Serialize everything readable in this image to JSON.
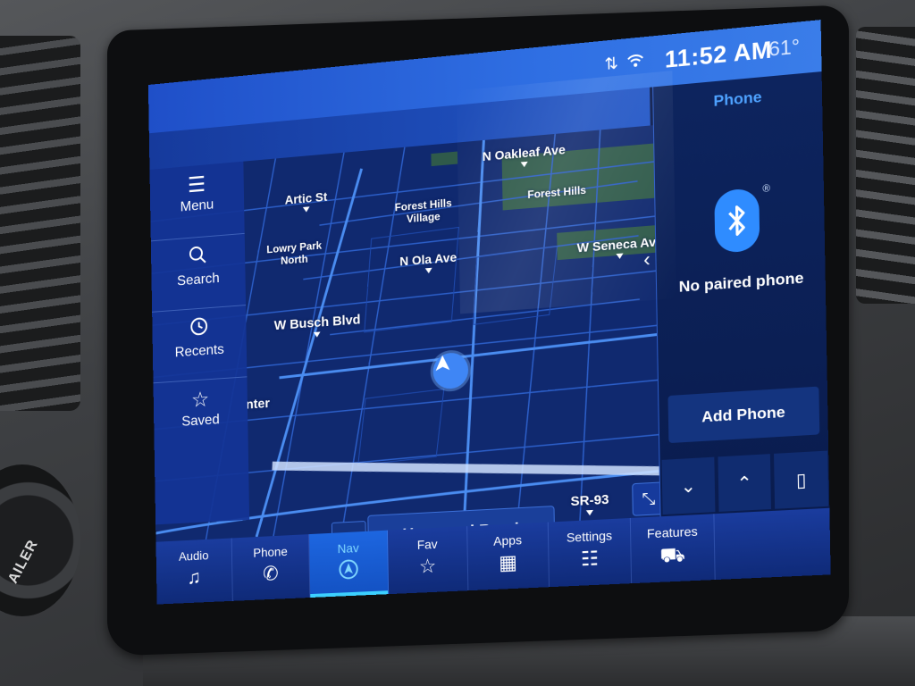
{
  "status": {
    "time": "11:52 AM",
    "temperature": "61°",
    "signal_icon": "signal-arrows-icon",
    "wifi_icon": "wifi-icon"
  },
  "side_menu": {
    "items": [
      {
        "label": "Menu",
        "icon": "hamburger-icon"
      },
      {
        "label": "Search",
        "icon": "search-icon"
      },
      {
        "label": "Recents",
        "icon": "clock-icon"
      },
      {
        "label": "Saved",
        "icon": "star-icon"
      }
    ]
  },
  "map": {
    "labels": {
      "oakleaf": "N Oakleaf Ave",
      "artic": "Artic St",
      "forest_hills_village": "Forest Hills Village",
      "forest_hills": "Forest Hills",
      "lowry_park": "Lowry Park North",
      "ola": "N Ola Ave",
      "seneca": "W Seneca Ave",
      "busch": "W Busch Blvd",
      "inter": "nter"
    },
    "current_road": "Unnamed Road",
    "heading": "W",
    "route": "SR-93"
  },
  "phone_panel": {
    "title": "Phone",
    "status": "No paired phone",
    "add_button": "Add Phone",
    "registered_mark": "®"
  },
  "bottom_nav": {
    "items": [
      {
        "label": "Audio",
        "icon": "music-note-icon"
      },
      {
        "label": "Phone",
        "icon": "phone-icon"
      },
      {
        "label": "Nav",
        "icon": "navigation-icon",
        "active": true
      },
      {
        "label": "Fav",
        "icon": "star-icon"
      },
      {
        "label": "Apps",
        "icon": "grid-icon"
      },
      {
        "label": "Settings",
        "icon": "sliders-icon"
      },
      {
        "label": "Features",
        "icon": "truck-icon"
      }
    ]
  },
  "dashboard": {
    "knob_label": "AILER"
  },
  "colors": {
    "accent": "#2f6fe3",
    "active_nav": "#3cd0ff",
    "bluetooth": "#2f8cff",
    "map_bg": "#10296f"
  }
}
